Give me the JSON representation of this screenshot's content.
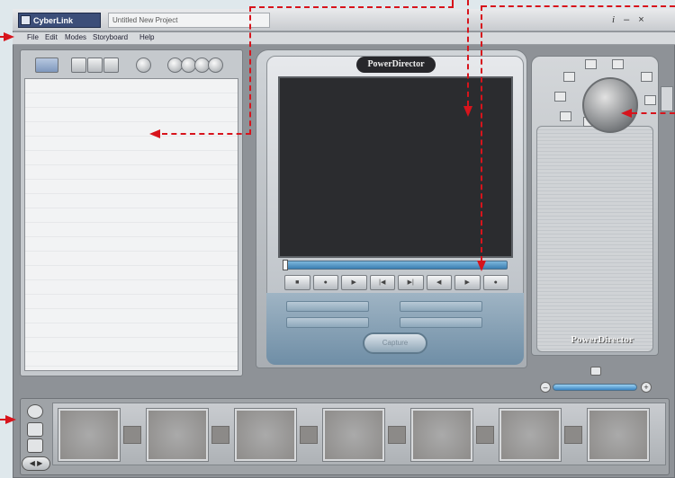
{
  "app": {
    "logo_text": "CyberLink",
    "project_title": "Untitled New Project",
    "window_buttons": [
      "i",
      "–",
      "×"
    ]
  },
  "menu": [
    "File",
    "Edit",
    "Modes",
    "Storyboard",
    "Help"
  ],
  "preview": {
    "brand": "PowerDirector",
    "controls": [
      "■",
      "●",
      "▶",
      "|◀",
      "▶|",
      "◀",
      "▶",
      "●"
    ],
    "capture_label": "Capture"
  },
  "right_panel": {
    "brand": "PowerDirector"
  },
  "volume": {
    "minus": "–",
    "plus": "+"
  },
  "storyboard": {
    "clip_count": 7,
    "nav_label": "◀ ▶"
  },
  "colors": {
    "annotation": "#d7141c",
    "seekbar": "#3b7fb2",
    "title_bg": "#3c4e79"
  }
}
